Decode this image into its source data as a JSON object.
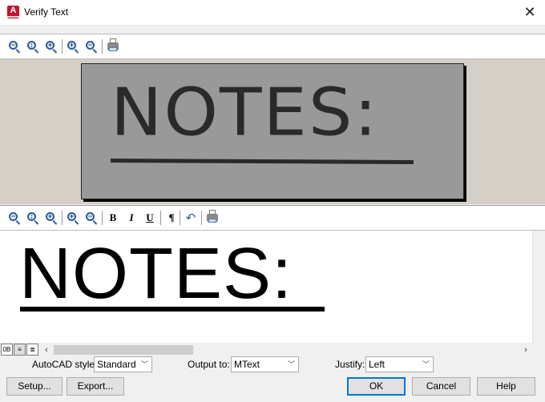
{
  "window": {
    "title": "Verify Text",
    "close_glyph": "✕",
    "app_icon_letter": "A"
  },
  "toolbar_top": {
    "icons": [
      "zoom-out-icon",
      "zoom-fit-icon",
      "zoom-extents-icon",
      "zoom-in-icon",
      "zoom-out-minus-icon",
      "print-icon"
    ]
  },
  "scanned_image": {
    "text": "NOTES:"
  },
  "toolbar_bottom": {
    "bold_label": "B",
    "italic_label": "I",
    "underline_label": "U",
    "paragraph_label": "¶",
    "undo_glyph": "↶"
  },
  "recognized_text": {
    "text": "NOTES: "
  },
  "view_modes": [
    "0B",
    "≡",
    "≣"
  ],
  "options": {
    "style_label": "AutoCAD style:",
    "style_value": "Standard",
    "output_label": "Output to:",
    "output_value": "MText",
    "justify_label": "Justify:",
    "justify_value": "Left"
  },
  "buttons": {
    "setup": "Setup...",
    "export": "Export...",
    "ok": "OK",
    "cancel": "Cancel",
    "help": "Help"
  },
  "colors": {
    "accent": "#0078d7",
    "app_icon": "#c8102e",
    "scan_bg": "#999999",
    "image_panel_bg": "#d4d0c8"
  }
}
